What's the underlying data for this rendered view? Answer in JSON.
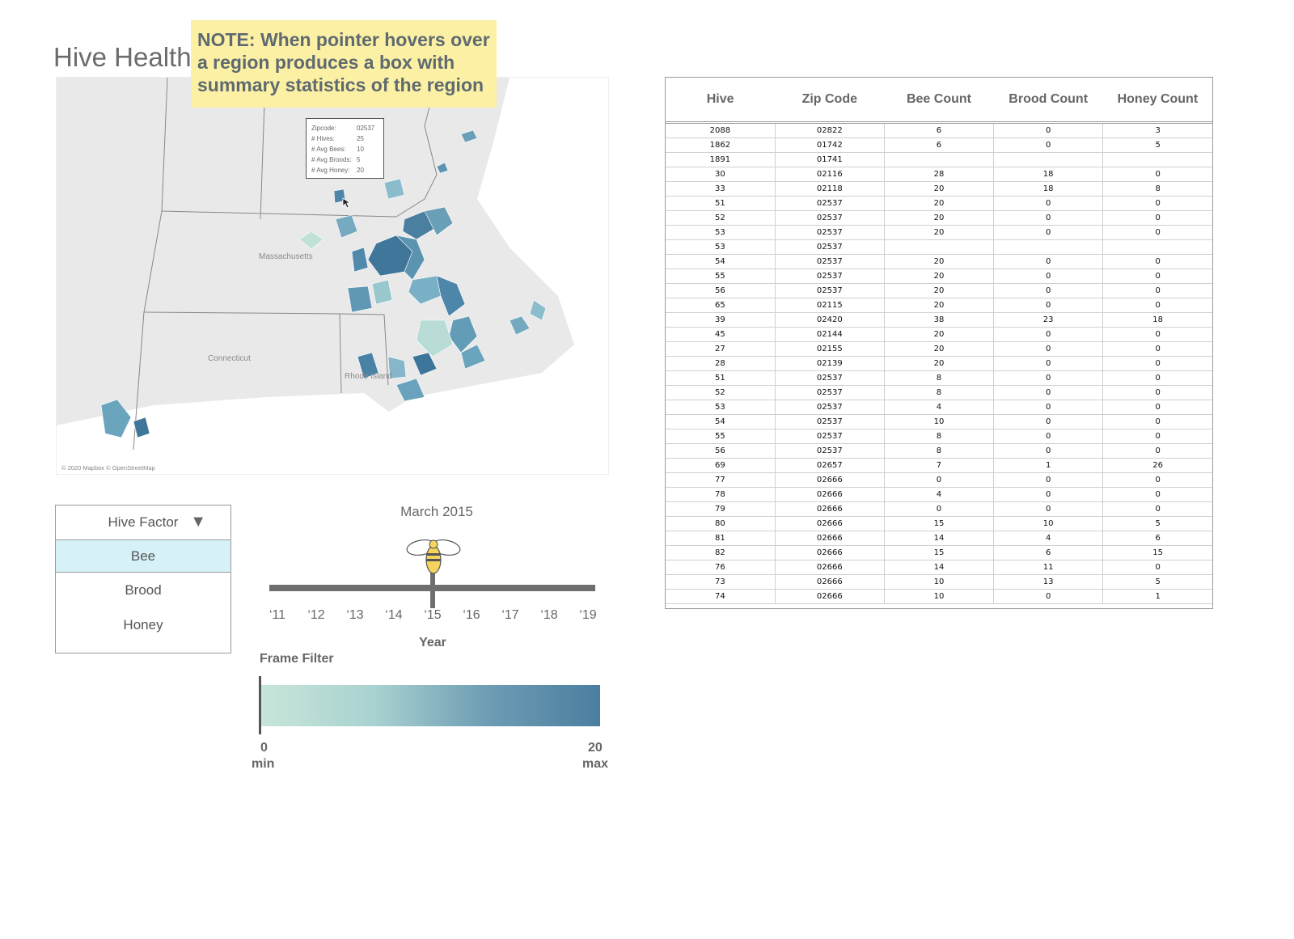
{
  "page": {
    "title": "Hive Health",
    "note": "NOTE: When pointer hovers over a region produces a box with summary statistics of the region"
  },
  "map": {
    "labels": [
      "Massachusetts",
      "Connecticut",
      "Rhode Island"
    ],
    "attribution": "© 2020 Mapbox © OpenStreetMap",
    "tooltip": {
      "rows": [
        {
          "key": "Zipcode:",
          "value": "02537"
        },
        {
          "key": "# Hives:",
          "value": "25"
        },
        {
          "key": "# Avg Bees:",
          "value": "10"
        },
        {
          "key": "# Avg Broods:",
          "value": "5"
        },
        {
          "key": "# Avg Honey:",
          "value": "20"
        }
      ]
    }
  },
  "hive_factor": {
    "label": "Hive Factor",
    "arrow": "▼",
    "options": [
      "Bee",
      "Brood",
      "Honey"
    ],
    "selected": "Bee"
  },
  "timeline": {
    "title": "March 2015",
    "ticks": [
      "‘11",
      "‘12",
      "‘13",
      "‘14",
      "‘15",
      "‘16",
      "‘17",
      "‘18",
      "‘19"
    ],
    "selected_tick": "‘15",
    "axis_label": "Year",
    "handle_icon": "bee-icon"
  },
  "frame_filter": {
    "title": "Frame Filter",
    "min_value": "0",
    "max_value": "20",
    "min_label": "min",
    "max_label": "max",
    "colors": [
      "#c8e6da",
      "#4b7ea0"
    ]
  },
  "table": {
    "columns": [
      "Hive",
      "Zip Code",
      "Bee Count",
      "Brood Count",
      "Honey Count"
    ],
    "rows": [
      [
        "2088",
        "02822",
        "6",
        "0",
        "3"
      ],
      [
        "1862",
        "01742",
        "6",
        "0",
        "5"
      ],
      [
        "1891",
        "01741",
        "",
        "",
        ""
      ],
      [
        "30",
        "02116",
        "28",
        "18",
        "0"
      ],
      [
        "33",
        "02118",
        "20",
        "18",
        "8"
      ],
      [
        "51",
        "02537",
        "20",
        "0",
        "0"
      ],
      [
        "52",
        "02537",
        "20",
        "0",
        "0"
      ],
      [
        "53",
        "02537",
        "20",
        "0",
        "0"
      ],
      [
        "53",
        "02537",
        "",
        "",
        ""
      ],
      [
        "54",
        "02537",
        "20",
        "0",
        "0"
      ],
      [
        "55",
        "02537",
        "20",
        "0",
        "0"
      ],
      [
        "56",
        "02537",
        "20",
        "0",
        "0"
      ],
      [
        "65",
        "02115",
        "20",
        "0",
        "0"
      ],
      [
        "39",
        "02420",
        "38",
        "23",
        "18"
      ],
      [
        "45",
        "02144",
        "20",
        "0",
        "0"
      ],
      [
        "27",
        "02155",
        "20",
        "0",
        "0"
      ],
      [
        "28",
        "02139",
        "20",
        "0",
        "0"
      ],
      [
        "51",
        "02537",
        "8",
        "0",
        "0"
      ],
      [
        "52",
        "02537",
        "8",
        "0",
        "0"
      ],
      [
        "53",
        "02537",
        "4",
        "0",
        "0"
      ],
      [
        "54",
        "02537",
        "10",
        "0",
        "0"
      ],
      [
        "55",
        "02537",
        "8",
        "0",
        "0"
      ],
      [
        "56",
        "02537",
        "8",
        "0",
        "0"
      ],
      [
        "69",
        "02657",
        "7",
        "1",
        "26"
      ],
      [
        "77",
        "02666",
        "0",
        "0",
        "0"
      ],
      [
        "78",
        "02666",
        "4",
        "0",
        "0"
      ],
      [
        "79",
        "02666",
        "0",
        "0",
        "0"
      ],
      [
        "80",
        "02666",
        "15",
        "10",
        "5"
      ],
      [
        "81",
        "02666",
        "14",
        "4",
        "6"
      ],
      [
        "82",
        "02666",
        "15",
        "6",
        "15"
      ],
      [
        "76",
        "02666",
        "14",
        "11",
        "0"
      ],
      [
        "73",
        "02666",
        "10",
        "13",
        "5"
      ],
      [
        "74",
        "02666",
        "10",
        "0",
        "1"
      ]
    ]
  }
}
